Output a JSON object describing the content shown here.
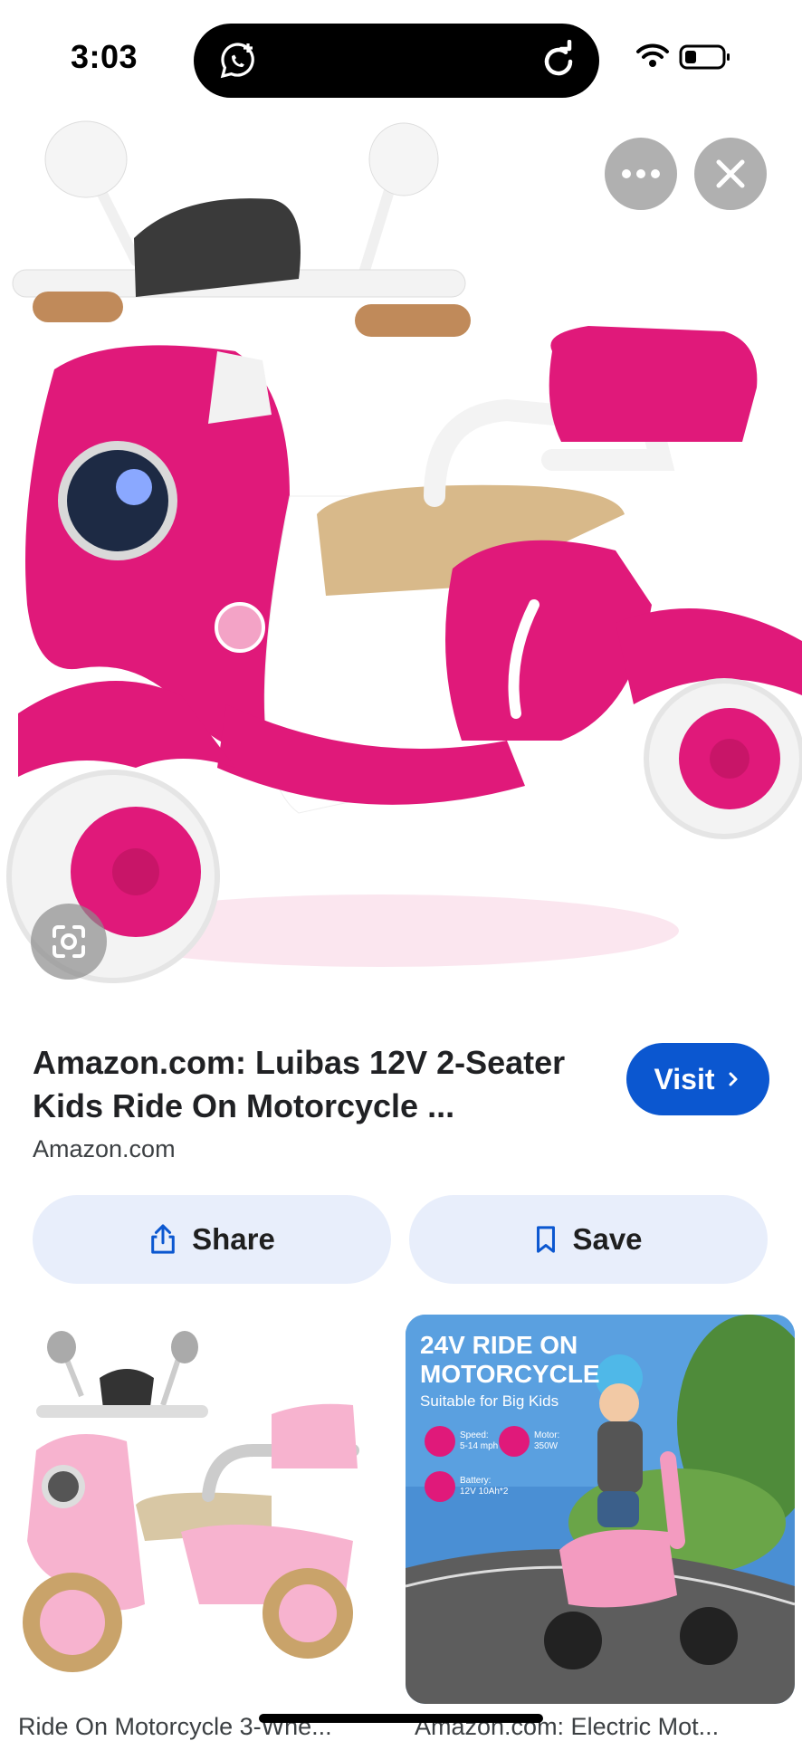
{
  "status_bar": {
    "time": "3:03"
  },
  "controls": {
    "more_icon": "more-horizontal-icon",
    "close_icon": "close-icon",
    "lens_icon": "visual-search-icon"
  },
  "result": {
    "title": "Amazon.com: Luibas 12V 2-Seater Kids Ride On Motorcycle ...",
    "source": "Amazon.com",
    "visit_label": "Visit",
    "share_label": "Share",
    "save_label": "Save"
  },
  "related": [
    {
      "caption": "Ride On Motorcycle 3-Whe..."
    },
    {
      "caption": "Amazon.com: Electric Mot...",
      "ad_headline": "24V RIDE ON MOTORCYCLE",
      "ad_subline": "Suitable for Big Kids",
      "spec_speed_label": "Speed:",
      "spec_speed_value": "5-14 mph",
      "spec_motor_label": "Motor:",
      "spec_motor_value": "350W",
      "spec_battery_label": "Battery:",
      "spec_battery_value": "12V 10Ah*2"
    }
  ],
  "colors": {
    "accent": "#0b57d0",
    "pill_bg": "#e8eefb",
    "scooter_pink": "#e0197a"
  }
}
